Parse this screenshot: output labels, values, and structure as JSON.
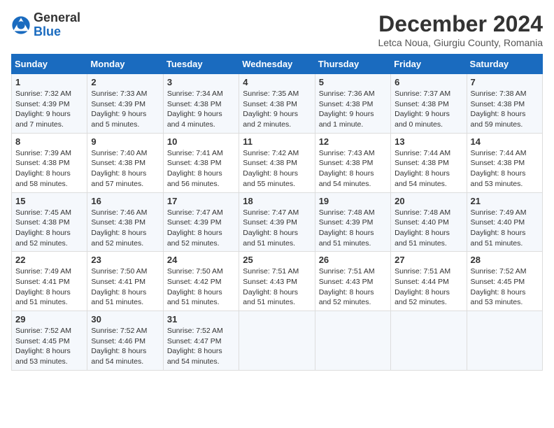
{
  "header": {
    "logo_general": "General",
    "logo_blue": "Blue",
    "month_title": "December 2024",
    "subtitle": "Letca Noua, Giurgiu County, Romania"
  },
  "days_of_week": [
    "Sunday",
    "Monday",
    "Tuesday",
    "Wednesday",
    "Thursday",
    "Friday",
    "Saturday"
  ],
  "weeks": [
    [
      {
        "day": 1,
        "info": "Sunrise: 7:32 AM\nSunset: 4:39 PM\nDaylight: 9 hours and 7 minutes."
      },
      {
        "day": 2,
        "info": "Sunrise: 7:33 AM\nSunset: 4:39 PM\nDaylight: 9 hours and 5 minutes."
      },
      {
        "day": 3,
        "info": "Sunrise: 7:34 AM\nSunset: 4:38 PM\nDaylight: 9 hours and 4 minutes."
      },
      {
        "day": 4,
        "info": "Sunrise: 7:35 AM\nSunset: 4:38 PM\nDaylight: 9 hours and 2 minutes."
      },
      {
        "day": 5,
        "info": "Sunrise: 7:36 AM\nSunset: 4:38 PM\nDaylight: 9 hours and 1 minute."
      },
      {
        "day": 6,
        "info": "Sunrise: 7:37 AM\nSunset: 4:38 PM\nDaylight: 9 hours and 0 minutes."
      },
      {
        "day": 7,
        "info": "Sunrise: 7:38 AM\nSunset: 4:38 PM\nDaylight: 8 hours and 59 minutes."
      }
    ],
    [
      {
        "day": 8,
        "info": "Sunrise: 7:39 AM\nSunset: 4:38 PM\nDaylight: 8 hours and 58 minutes."
      },
      {
        "day": 9,
        "info": "Sunrise: 7:40 AM\nSunset: 4:38 PM\nDaylight: 8 hours and 57 minutes."
      },
      {
        "day": 10,
        "info": "Sunrise: 7:41 AM\nSunset: 4:38 PM\nDaylight: 8 hours and 56 minutes."
      },
      {
        "day": 11,
        "info": "Sunrise: 7:42 AM\nSunset: 4:38 PM\nDaylight: 8 hours and 55 minutes."
      },
      {
        "day": 12,
        "info": "Sunrise: 7:43 AM\nSunset: 4:38 PM\nDaylight: 8 hours and 54 minutes."
      },
      {
        "day": 13,
        "info": "Sunrise: 7:44 AM\nSunset: 4:38 PM\nDaylight: 8 hours and 54 minutes."
      },
      {
        "day": 14,
        "info": "Sunrise: 7:44 AM\nSunset: 4:38 PM\nDaylight: 8 hours and 53 minutes."
      }
    ],
    [
      {
        "day": 15,
        "info": "Sunrise: 7:45 AM\nSunset: 4:38 PM\nDaylight: 8 hours and 52 minutes."
      },
      {
        "day": 16,
        "info": "Sunrise: 7:46 AM\nSunset: 4:38 PM\nDaylight: 8 hours and 52 minutes."
      },
      {
        "day": 17,
        "info": "Sunrise: 7:47 AM\nSunset: 4:39 PM\nDaylight: 8 hours and 52 minutes."
      },
      {
        "day": 18,
        "info": "Sunrise: 7:47 AM\nSunset: 4:39 PM\nDaylight: 8 hours and 51 minutes."
      },
      {
        "day": 19,
        "info": "Sunrise: 7:48 AM\nSunset: 4:39 PM\nDaylight: 8 hours and 51 minutes."
      },
      {
        "day": 20,
        "info": "Sunrise: 7:48 AM\nSunset: 4:40 PM\nDaylight: 8 hours and 51 minutes."
      },
      {
        "day": 21,
        "info": "Sunrise: 7:49 AM\nSunset: 4:40 PM\nDaylight: 8 hours and 51 minutes."
      }
    ],
    [
      {
        "day": 22,
        "info": "Sunrise: 7:49 AM\nSunset: 4:41 PM\nDaylight: 8 hours and 51 minutes."
      },
      {
        "day": 23,
        "info": "Sunrise: 7:50 AM\nSunset: 4:41 PM\nDaylight: 8 hours and 51 minutes."
      },
      {
        "day": 24,
        "info": "Sunrise: 7:50 AM\nSunset: 4:42 PM\nDaylight: 8 hours and 51 minutes."
      },
      {
        "day": 25,
        "info": "Sunrise: 7:51 AM\nSunset: 4:43 PM\nDaylight: 8 hours and 51 minutes."
      },
      {
        "day": 26,
        "info": "Sunrise: 7:51 AM\nSunset: 4:43 PM\nDaylight: 8 hours and 52 minutes."
      },
      {
        "day": 27,
        "info": "Sunrise: 7:51 AM\nSunset: 4:44 PM\nDaylight: 8 hours and 52 minutes."
      },
      {
        "day": 28,
        "info": "Sunrise: 7:52 AM\nSunset: 4:45 PM\nDaylight: 8 hours and 53 minutes."
      }
    ],
    [
      {
        "day": 29,
        "info": "Sunrise: 7:52 AM\nSunset: 4:45 PM\nDaylight: 8 hours and 53 minutes."
      },
      {
        "day": 30,
        "info": "Sunrise: 7:52 AM\nSunset: 4:46 PM\nDaylight: 8 hours and 54 minutes."
      },
      {
        "day": 31,
        "info": "Sunrise: 7:52 AM\nSunset: 4:47 PM\nDaylight: 8 hours and 54 minutes."
      },
      null,
      null,
      null,
      null
    ]
  ]
}
